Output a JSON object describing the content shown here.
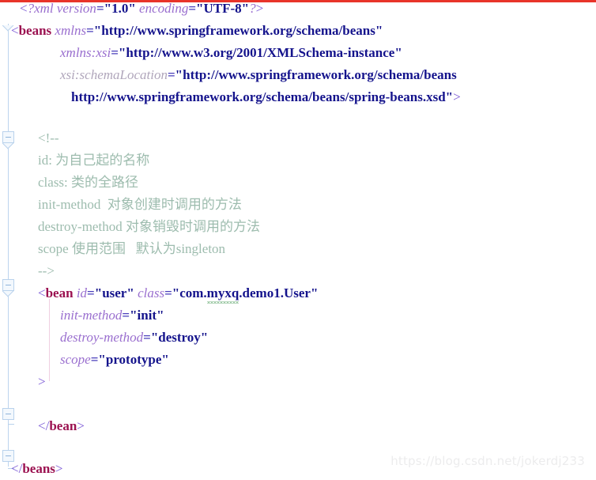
{
  "document": {
    "kind": "xml-source",
    "filename_hint": "spring bean configuration",
    "watermark": "https://blog.csdn.net/jokerdj233"
  },
  "colors": {
    "background": "#ffffff",
    "tag": "#9b1150",
    "bracket": "#7c5ad6",
    "attribute": "#9a6fcf",
    "attribute_value": "#14138c",
    "comment": "#9dbcae",
    "equals": "#4a3fbb",
    "top_rule": "#e8342a",
    "gutter_line": "#bdd4ee",
    "indent_guide": "#f0cfe2",
    "squiggle": "#7fb98a",
    "watermark": "#ececed"
  },
  "lines": {
    "l1": {
      "open": "<",
      "pi_open": "?xml",
      "attr_version": "version",
      "eq1": "=",
      "q1": "\"",
      "val_version": "1.0",
      "q2": "\"",
      "attr_encoding": "encoding",
      "eq2": "=",
      "q3": "\"",
      "val_encoding": "UTF-8",
      "q4": "\"",
      "pi_close": "?",
      "close": ">"
    },
    "l2": {
      "open": "<",
      "tag": "beans",
      "attr": "xmlns",
      "eq": "=",
      "q1": "\"",
      "value": "http://www.springframework.org/schema/beans",
      "q2": "\""
    },
    "l3": {
      "attr": "xmlns:xsi",
      "eq": "=",
      "q1": "\"",
      "value": "http://www.w3.org/2001/XMLSchema-instance",
      "q2": "\""
    },
    "l4": {
      "attr": "xsi:schemaLocation",
      "eq": "=",
      "q1": "\"",
      "value": "http://www.springframework.org/schema/beans"
    },
    "l5": {
      "value": "http://www.springframework.org/schema/beans/spring-beans.xsd",
      "q2": "\"",
      "close": ">"
    },
    "c1": "<!--",
    "c2": "id: 为自己起的名称",
    "c3": "class: 类的全路径",
    "c4": "init-method  对象创建时调用的方法",
    "c5": "destroy-method 对象销毁时调用的方法",
    "c6": "scope 使用范围   默认为singleton",
    "c7": "-->",
    "l6": {
      "open": "<",
      "tag": "bean",
      "attr_id": "id",
      "eq1": "=",
      "q1": "\"",
      "val_id": "user",
      "q2": "\"",
      "attr_class": "class",
      "eq2": "=",
      "q3": "\"",
      "val_class_prefix": "com.",
      "val_class_squiggle": "myxq",
      "val_class_suffix": ".demo1.User",
      "q4": "\""
    },
    "l7": {
      "attr": "init-method",
      "eq": "=",
      "q1": "\"",
      "value": "init",
      "q2": "\""
    },
    "l8": {
      "attr": "destroy-method",
      "eq": "=",
      "q1": "\"",
      "value": "destroy",
      "q2": "\""
    },
    "l9": {
      "attr": "scope",
      "eq": "=",
      "q1": "\"",
      "value": "prototype",
      "q2": "\""
    },
    "l10": {
      "close": ">"
    },
    "l11": {
      "open": "</",
      "tag": "bean",
      "close": ">"
    },
    "l12": {
      "open": "</",
      "tag": "beans",
      "close": ">"
    }
  }
}
